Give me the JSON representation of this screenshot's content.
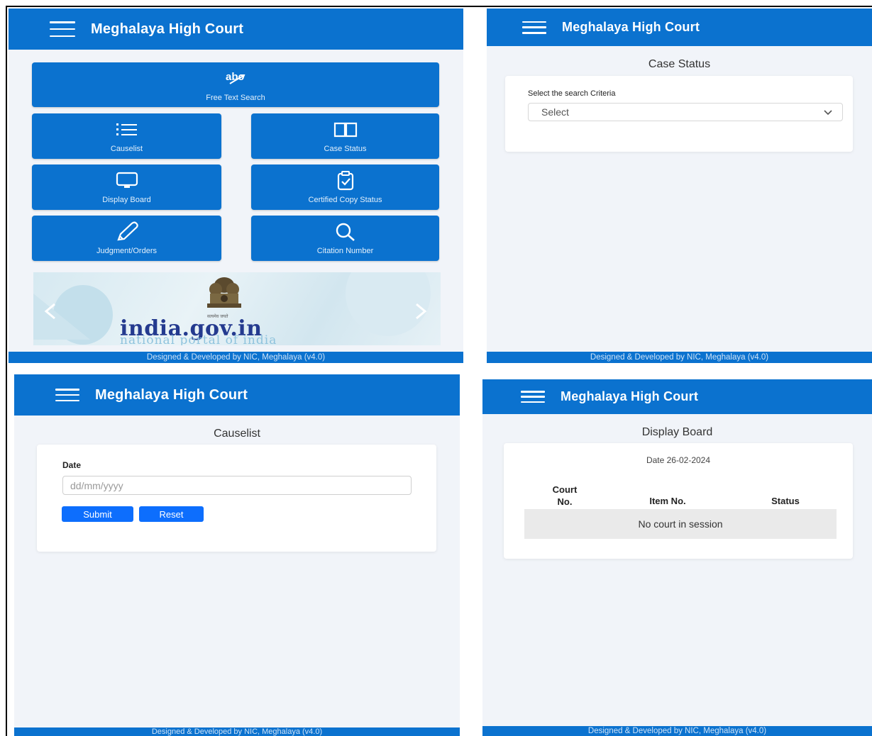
{
  "app": {
    "title": "Meghalaya High Court",
    "footer": "Designed & Developed by NIC, Meghalaya (v4.0)"
  },
  "colors": {
    "header_blue": "#0b72cf",
    "tile_blue": "#0b72cf",
    "button_blue": "#0d6efd",
    "panel_bg": "#f1f4f9"
  },
  "home": {
    "tiles": [
      {
        "label": "Free Text Search",
        "icon": "abc-icon"
      },
      {
        "label": "Causelist",
        "icon": "list-icon"
      },
      {
        "label": "Case Status",
        "icon": "book-icon"
      },
      {
        "label": "Display Board",
        "icon": "monitor-icon"
      },
      {
        "label": "Certified Copy Status",
        "icon": "clipboard-check-icon"
      },
      {
        "label": "Judgment/Orders",
        "icon": "pencil-icon"
      },
      {
        "label": "Citation Number",
        "icon": "search-icon"
      }
    ],
    "banner": {
      "emblem_caption": "सत्यमेव जयते",
      "site": "india.gov.in",
      "tagline": "national portal of india"
    }
  },
  "case_status": {
    "title": "Case Status",
    "criteria_label": "Select the search Criteria",
    "select_value": "Select"
  },
  "causelist": {
    "title": "Causelist",
    "date_label": "Date",
    "date_placeholder": "dd/mm/yyyy",
    "submit_label": "Submit",
    "reset_label": "Reset"
  },
  "display_board": {
    "title": "Display Board",
    "date_text": "Date 26-02-2024",
    "columns": [
      "Court No.",
      "Item No.",
      "Status"
    ],
    "column_court_line1": "Court",
    "column_court_line2": "No.",
    "empty_message": "No court in session"
  }
}
